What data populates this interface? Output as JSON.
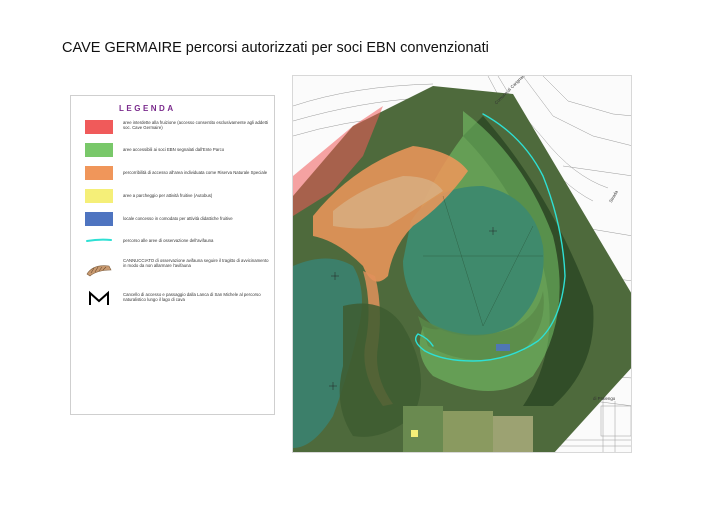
{
  "title": "CAVE GERMAIRE percorsi autorizzati per soci EBN convenzionati",
  "legend": {
    "title": "LEGENDA",
    "items": [
      {
        "color": "#f05a5a",
        "text": "aree interdette alla fruizione (accesso consentito esclusivamente agli addetti soc. Cave Germaire)"
      },
      {
        "color": "#79c86a",
        "text": "aree accessibili ai soci EBN segnalati dall'Ente Parco"
      },
      {
        "color": "#f0965a",
        "text": "percorribilità di accesso all'area individuata come Riserva Naturale Speciale"
      },
      {
        "color": "#f5ef78",
        "text": "aree a parcheggio per attività fruitive (Autobus)"
      },
      {
        "color": "#4e74c0",
        "text": "locale concesso in comodato per attività didattiche fruitive"
      },
      {
        "color": "#2ee0d4",
        "text": "percorso alle aree di osservazione dell'avifauna"
      },
      {
        "color": "#c99a70",
        "text": "CANNUCCIATO di osservazione avifauna seguire il tragitto di avvicinamento in modo da non allarmare l'avifauna"
      },
      {
        "color": "#000000",
        "text": "Cancello di accesso e passaggio dalla Lanca di San Michele al percorso naturalistico lungo il lago di cava"
      }
    ]
  },
  "map": {
    "labels": {
      "road_north": "Comune di Carignano",
      "road_east": "Strada",
      "road_south": "di Pralengo"
    }
  }
}
